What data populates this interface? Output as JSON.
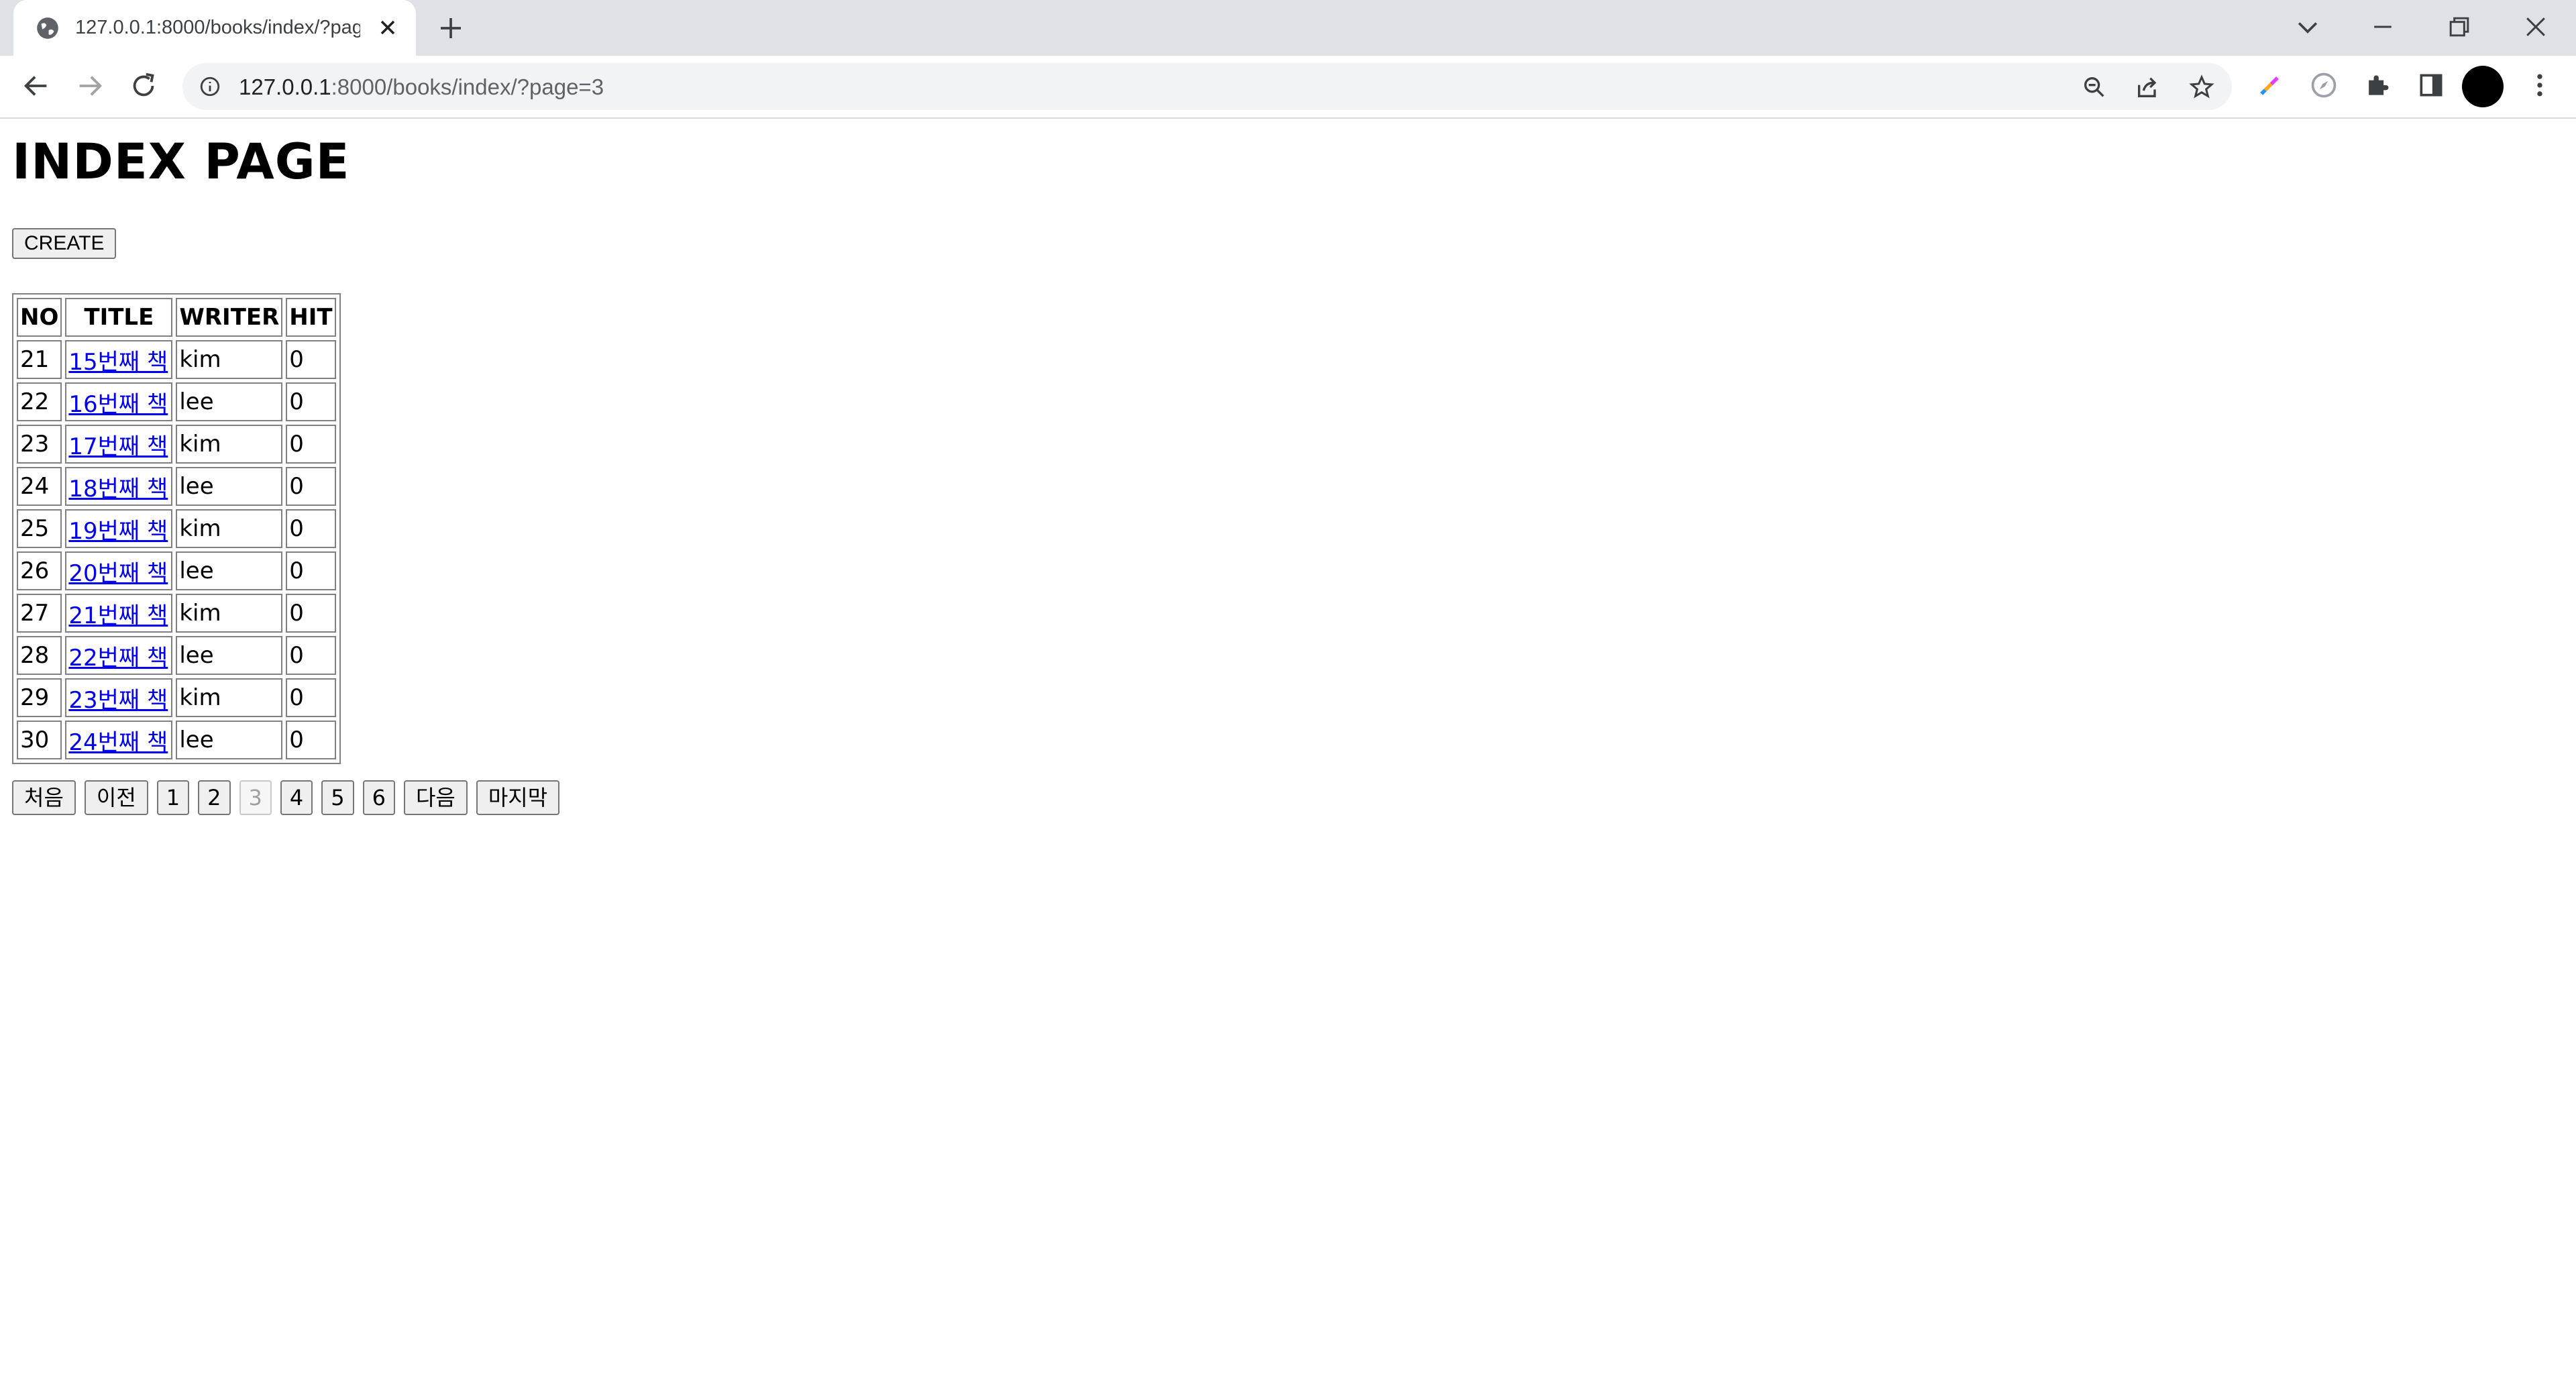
{
  "browser": {
    "tab_title": "127.0.0.1:8000/books/index/?page=3",
    "url_host": "127.0.0.1",
    "url_rest": ":8000/books/index/?page=3"
  },
  "page": {
    "title": "INDEX PAGE",
    "create_label": "CREATE",
    "columns": [
      "NO",
      "TITLE",
      "WRITER",
      "HIT"
    ],
    "rows": [
      {
        "no": "21",
        "title": "15번째 책",
        "writer": "kim",
        "hit": "0"
      },
      {
        "no": "22",
        "title": "16번째 책",
        "writer": "lee",
        "hit": "0"
      },
      {
        "no": "23",
        "title": "17번째 책",
        "writer": "kim",
        "hit": "0"
      },
      {
        "no": "24",
        "title": "18번째 책",
        "writer": "lee",
        "hit": "0"
      },
      {
        "no": "25",
        "title": "19번째 책",
        "writer": "kim",
        "hit": "0"
      },
      {
        "no": "26",
        "title": "20번째 책",
        "writer": "lee",
        "hit": "0"
      },
      {
        "no": "27",
        "title": "21번째 책",
        "writer": "kim",
        "hit": "0"
      },
      {
        "no": "28",
        "title": "22번째 책",
        "writer": "lee",
        "hit": "0"
      },
      {
        "no": "29",
        "title": "23번째 책",
        "writer": "kim",
        "hit": "0"
      },
      {
        "no": "30",
        "title": "24번째 책",
        "writer": "lee",
        "hit": "0"
      }
    ],
    "pagination": {
      "first": "처음",
      "prev": "이전",
      "pages": [
        "1",
        "2",
        "3",
        "4",
        "5",
        "6"
      ],
      "current": "3",
      "next": "다음",
      "last": "마지막"
    }
  },
  "icons": {
    "tab_favicon": "globe-icon",
    "tab_close": "close-icon",
    "new_tab": "plus-icon",
    "tab_search": "chevron-down-icon",
    "minimize": "minimize-icon",
    "restore": "restore-icon",
    "close_window": "close-icon",
    "back": "arrow-left-icon",
    "forward": "arrow-right-icon",
    "reload": "reload-icon",
    "site_info": "info-icon",
    "zoom": "zoom-icon",
    "share": "share-icon",
    "bookmark": "star-icon",
    "extensions": "puzzle-icon",
    "side_panel": "side-panel-icon",
    "menu": "kebab-menu-icon"
  },
  "colors": {
    "link": "#0000ee",
    "tabstrip": "#dee1e6",
    "omnibox": "#f1f3f4"
  }
}
